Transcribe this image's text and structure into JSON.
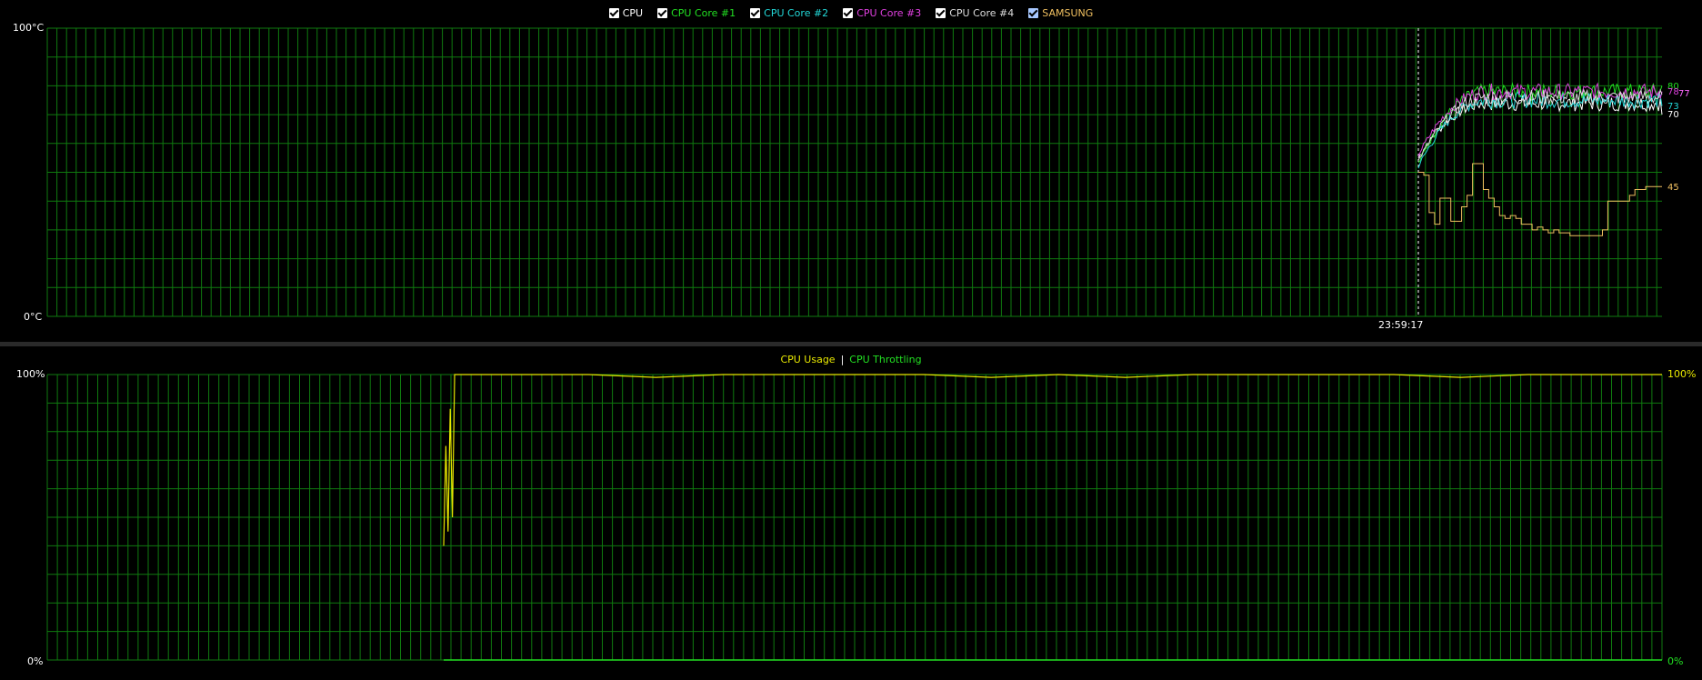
{
  "temperature_chart": {
    "legend": [
      {
        "label": "CPU",
        "color": "#ffffff",
        "checkbox": "#ffffff"
      },
      {
        "label": "CPU Core #1",
        "color": "#22e022",
        "checkbox": "#ffffff"
      },
      {
        "label": "CPU Core #2",
        "color": "#22d8d8",
        "checkbox": "#ffffff"
      },
      {
        "label": "CPU Core #3",
        "color": "#e040e0",
        "checkbox": "#ffffff"
      },
      {
        "label": "CPU Core #4",
        "color": "#dddddd",
        "checkbox": "#ffffff"
      },
      {
        "label": "SAMSUNG",
        "color": "#f0c060",
        "checkbox": "#a8c8ff"
      }
    ],
    "y_max_label": "100°C",
    "y_min_label": "0°C",
    "marker_time": "23:59:17",
    "end_values": [
      {
        "value": "80",
        "color": "#22e022"
      },
      {
        "value": "78",
        "color": "#e040e0"
      },
      {
        "value": "77",
        "color": "#ff66ff"
      },
      {
        "value": "73",
        "color": "#22d8d8"
      },
      {
        "value": "70",
        "color": "#ffffff"
      },
      {
        "value": "45",
        "color": "#f0c060"
      }
    ]
  },
  "usage_chart": {
    "legend": [
      {
        "label": "CPU Usage",
        "color": "#e8e800"
      },
      {
        "label": "CPU Throttling",
        "color": "#22e022"
      }
    ],
    "separator": "|",
    "y_max_left": "100%",
    "y_min_left": "0%",
    "y_max_right": "100%",
    "y_min_right": "0%"
  },
  "chart_data": [
    {
      "type": "line",
      "y_unit": "°C",
      "ylim": [
        0,
        100
      ],
      "grid": true,
      "legend_position": "top-center",
      "x_marker": "23:59:17",
      "series": [
        {
          "name": "CPU",
          "color": "#ffffff",
          "start": 55,
          "plateau": 74,
          "noise": 4,
          "end": 70
        },
        {
          "name": "CPU Core #1",
          "color": "#22e022",
          "start": 53,
          "plateau": 78,
          "noise": 4,
          "end": 80
        },
        {
          "name": "CPU Core #2",
          "color": "#22d8d8",
          "start": 52,
          "plateau": 75,
          "noise": 4,
          "end": 73
        },
        {
          "name": "CPU Core #3",
          "color": "#e040e0",
          "start": 56,
          "plateau": 78,
          "noise": 4,
          "end": 78
        },
        {
          "name": "CPU Core #4",
          "color": "#dddddd",
          "start": 54,
          "plateau": 76,
          "noise": 4,
          "end": 77
        },
        {
          "name": "SAMSUNG",
          "color": "#f0c060",
          "values": [
            50,
            49,
            36,
            32,
            41,
            41,
            33,
            33,
            38,
            42,
            53,
            53,
            44,
            41,
            38,
            35,
            34,
            35,
            34,
            32,
            32,
            30,
            31,
            30,
            29,
            30,
            29,
            29,
            28,
            28,
            28,
            28,
            28,
            28,
            30,
            40,
            40,
            40,
            40,
            42,
            44,
            44,
            45,
            45,
            45
          ]
        }
      ]
    },
    {
      "type": "line",
      "y_unit": "%",
      "ylim": [
        0,
        100
      ],
      "grid": true,
      "legend_position": "top-center",
      "series": [
        {
          "name": "CPU Usage",
          "color": "#e8e800",
          "values": [
            40,
            75,
            45,
            88,
            50,
            99,
            100,
            100,
            100,
            99,
            100,
            100,
            100,
            100,
            99,
            100,
            99,
            100,
            100,
            100,
            100,
            99,
            100,
            100,
            100
          ]
        },
        {
          "name": "CPU Throttling",
          "color": "#22e022",
          "values": [
            0,
            0,
            0,
            0,
            0
          ]
        }
      ]
    }
  ]
}
